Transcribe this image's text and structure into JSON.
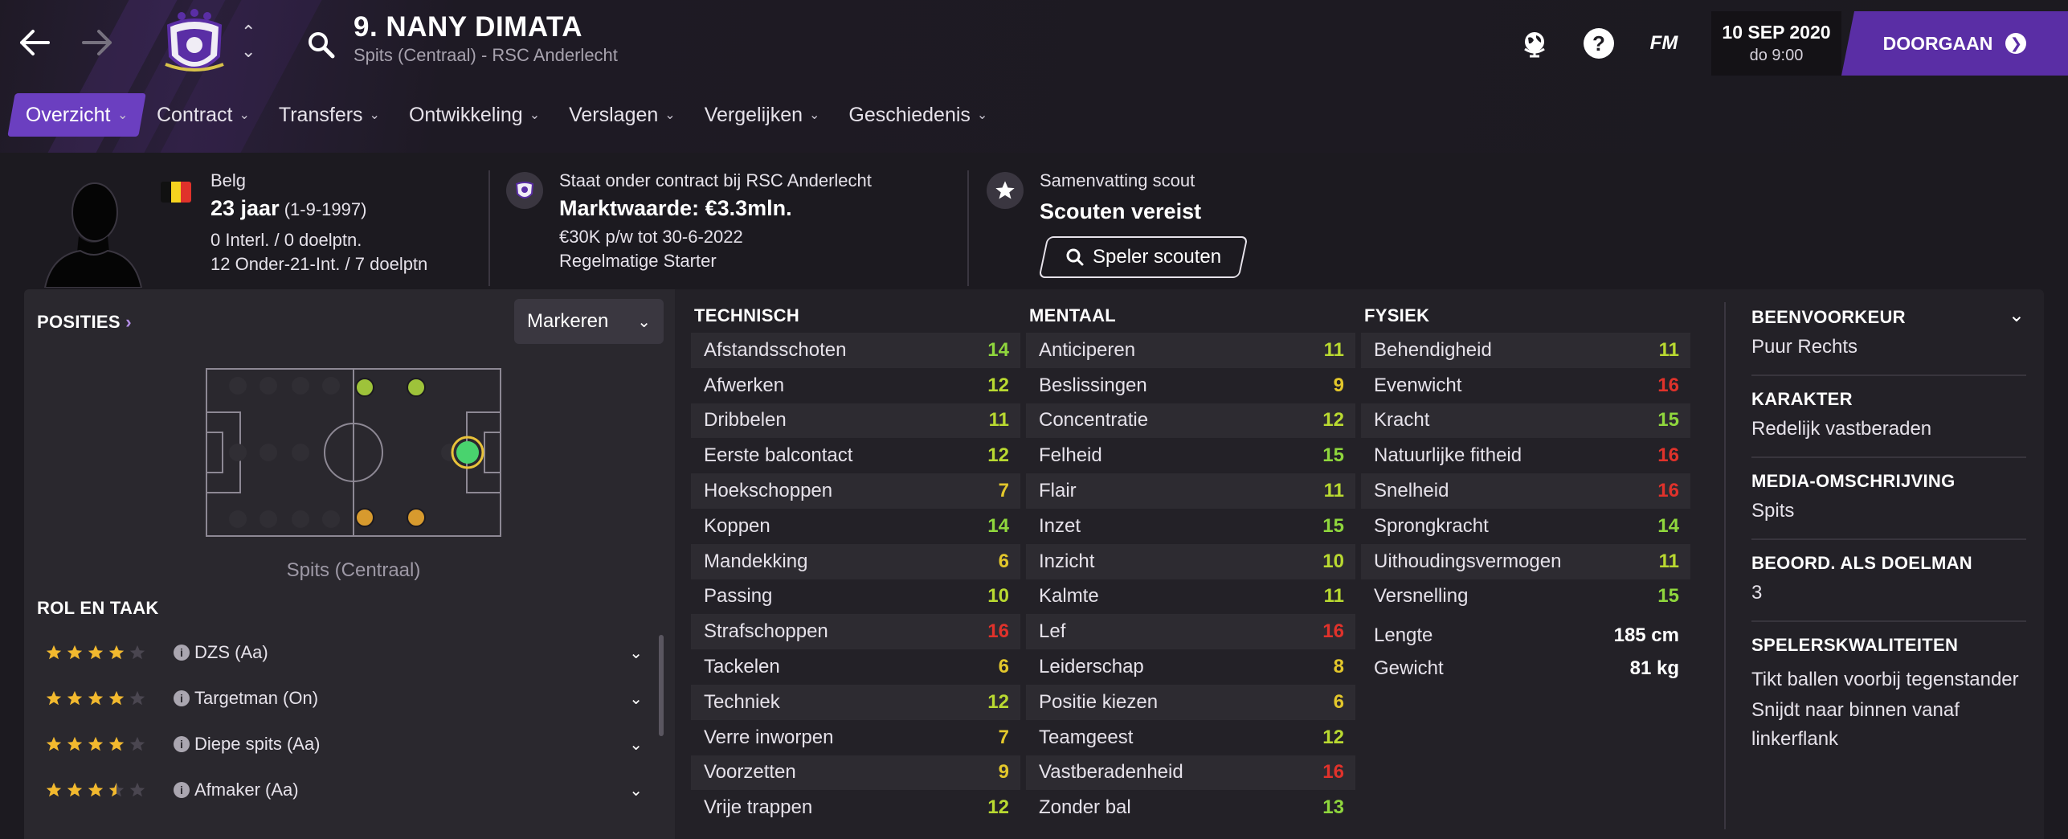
{
  "header": {
    "back_icon": "arrow-left-icon",
    "forward_icon": "arrow-right-icon",
    "player_name": "9. NANY DIMATA",
    "player_subtitle": "Spits (Centraal) - RSC Anderlecht",
    "fm_label": "FM",
    "date": "10 SEP 2020",
    "time": "do 9:00",
    "continue_label": "DOORGAAN",
    "accent_color": "#5a2ea5"
  },
  "tabs": [
    {
      "label": "Overzicht",
      "active": true
    },
    {
      "label": "Contract"
    },
    {
      "label": "Transfers"
    },
    {
      "label": "Ontwikkeling"
    },
    {
      "label": "Verslagen"
    },
    {
      "label": "Vergelijken"
    },
    {
      "label": "Geschiedenis"
    }
  ],
  "summary": {
    "nationality": "Belg",
    "age": "23 jaar",
    "birthdate": "(1-9-1997)",
    "caps": "0 Interl. / 0 doelptn.",
    "u21_caps": "12 Onder-21-Int. / 7 doelptn",
    "contract_status": "Staat onder contract bij RSC Anderlecht",
    "market_value": "Marktwaarde: €3.3mln.",
    "wage": "€30K p/w tot 30-6-2022",
    "squad_status": "Regelmatige Starter",
    "scout_title": "Samenvatting scout",
    "scout_status": "Scouten vereist",
    "scout_button": "Speler scouten"
  },
  "positions": {
    "title": "POSITIES",
    "mark_label": "Markeren",
    "caption": "Spits (Centraal)"
  },
  "roles": {
    "title": "ROL EN TAAK",
    "items": [
      {
        "label": "DZS (Aa)",
        "stars": 4
      },
      {
        "label": "Targetman (On)",
        "stars": 4
      },
      {
        "label": "Diepe spits (Aa)",
        "stars": 4
      },
      {
        "label": "Afmaker (Aa)",
        "stars": 3.5
      }
    ]
  },
  "technical": {
    "title": "TECHNISCH",
    "attrs": [
      {
        "label": "Afstandsschoten",
        "value": "14"
      },
      {
        "label": "Afwerken",
        "value": "12"
      },
      {
        "label": "Dribbelen",
        "value": "11"
      },
      {
        "label": "Eerste balcontact",
        "value": "12"
      },
      {
        "label": "Hoekschoppen",
        "value": "7"
      },
      {
        "label": "Koppen",
        "value": "14"
      },
      {
        "label": "Mandekking",
        "value": "6"
      },
      {
        "label": "Passing",
        "value": "10"
      },
      {
        "label": "Strafschoppen",
        "value": "16"
      },
      {
        "label": "Tackelen",
        "value": "6"
      },
      {
        "label": "Techniek",
        "value": "12"
      },
      {
        "label": "Verre inworpen",
        "value": "7"
      },
      {
        "label": "Voorzetten",
        "value": "9"
      },
      {
        "label": "Vrije trappen",
        "value": "12"
      }
    ]
  },
  "mental": {
    "title": "MENTAAL",
    "attrs": [
      {
        "label": "Anticiperen",
        "value": "11"
      },
      {
        "label": "Beslissingen",
        "value": "9"
      },
      {
        "label": "Concentratie",
        "value": "12"
      },
      {
        "label": "Felheid",
        "value": "15"
      },
      {
        "label": "Flair",
        "value": "11"
      },
      {
        "label": "Inzet",
        "value": "15"
      },
      {
        "label": "Inzicht",
        "value": "10"
      },
      {
        "label": "Kalmte",
        "value": "11"
      },
      {
        "label": "Lef",
        "value": "16"
      },
      {
        "label": "Leiderschap",
        "value": "8"
      },
      {
        "label": "Positie kiezen",
        "value": "6"
      },
      {
        "label": "Teamgeest",
        "value": "12"
      },
      {
        "label": "Vastberadenheid",
        "value": "16"
      },
      {
        "label": "Zonder bal",
        "value": "13"
      }
    ]
  },
  "physical": {
    "title": "FYSIEK",
    "attrs": [
      {
        "label": "Behendigheid",
        "value": "11"
      },
      {
        "label": "Evenwicht",
        "value": "16"
      },
      {
        "label": "Kracht",
        "value": "15"
      },
      {
        "label": "Natuurlijke fitheid",
        "value": "16"
      },
      {
        "label": "Snelheid",
        "value": "16"
      },
      {
        "label": "Sprongkracht",
        "value": "14"
      },
      {
        "label": "Uithoudingsvermogen",
        "value": "11"
      },
      {
        "label": "Versnelling",
        "value": "15"
      }
    ],
    "height_label": "Lengte",
    "height_value": "185 cm",
    "weight_label": "Gewicht",
    "weight_value": "81 kg"
  },
  "info": {
    "foot_title": "BEENVOORKEUR",
    "foot_value": "Puur Rechts",
    "character_title": "KARAKTER",
    "character_value": "Redelijk vastberaden",
    "media_title": "MEDIA-OMSCHRIJVING",
    "media_value": "Spits",
    "gk_title": "BEOORD. ALS DOELMAN",
    "gk_value": "3",
    "traits_title": "SPELERSKWALITEITEN",
    "traits": [
      "Tikt ballen voorbij tegenstander",
      "Snijdt naar binnen vanaf linkerflank"
    ]
  }
}
